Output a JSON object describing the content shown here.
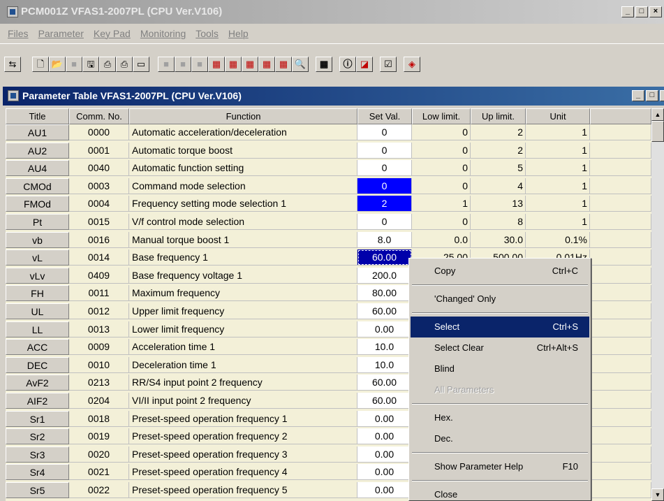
{
  "app": {
    "title": "PCM001Z VFAS1-2007PL (CPU Ver.V106)",
    "window_buttons": [
      "_",
      "□",
      "×"
    ]
  },
  "menu": [
    "Files",
    "Parameter",
    "Key Pad",
    "Monitoring",
    "Tools",
    "Help"
  ],
  "toolbar_icons": [
    "toggle-icon",
    "new-file-icon",
    "open-folder-icon",
    "blank-icon",
    "save-icon",
    "print-icon",
    "print-preview-icon",
    "window-icon",
    "blank-icon",
    "blank-icon",
    "blank-icon",
    "table-red-icon",
    "table-red-icon",
    "table-red-icon",
    "table-red-icon",
    "table-red-icon",
    "find-icon",
    "calculator-icon",
    "info-icon",
    "chart-icon",
    "checklist-icon",
    "book-icon"
  ],
  "child_window": {
    "title": "Parameter Table VFAS1-2007PL (CPU Ver.V106)"
  },
  "table": {
    "headers": [
      "Title",
      "Comm. No.",
      "Function",
      "Set Val.",
      "Low limit.",
      "Up limit.",
      "Unit",
      ""
    ],
    "rows": [
      {
        "title": "AU1",
        "comm": "0000",
        "func": "Automatic acceleration/deceleration",
        "set": "0",
        "low": "0",
        "up": "2",
        "unit": "1",
        "state": ""
      },
      {
        "title": "AU2",
        "comm": "0001",
        "func": "Automatic torque boost",
        "set": "0",
        "low": "0",
        "up": "2",
        "unit": "1",
        "state": ""
      },
      {
        "title": "AU4",
        "comm": "0040",
        "func": "Automatic function setting",
        "set": "0",
        "low": "0",
        "up": "5",
        "unit": "1",
        "state": ""
      },
      {
        "title": "CMOd",
        "comm": "0003",
        "func": "Command mode selection",
        "set": "0",
        "low": "0",
        "up": "4",
        "unit": "1",
        "state": "sel"
      },
      {
        "title": "FMOd",
        "comm": "0004",
        "func": "Frequency setting mode selection 1",
        "set": "2",
        "low": "1",
        "up": "13",
        "unit": "1",
        "state": "sel"
      },
      {
        "title": "Pt",
        "comm": "0015",
        "func": "V/f control mode selection",
        "set": "0",
        "low": "0",
        "up": "8",
        "unit": "1",
        "state": ""
      },
      {
        "title": "vb",
        "comm": "0016",
        "func": "Manual torque boost 1",
        "set": "8.0",
        "low": "0.0",
        "up": "30.0",
        "unit": "0.1%",
        "state": ""
      },
      {
        "title": "vL",
        "comm": "0014",
        "func": "Base frequency 1",
        "set": "60.00",
        "low": "25.00",
        "up": "500.00",
        "unit": "0.01Hz",
        "state": "focus"
      },
      {
        "title": "vLv",
        "comm": "0409",
        "func": "Base frequency voltage 1",
        "set": "200.0",
        "low": "",
        "up": "",
        "unit": "",
        "state": ""
      },
      {
        "title": "FH",
        "comm": "0011",
        "func": "Maximum frequency",
        "set": "80.00",
        "low": "",
        "up": "",
        "unit": "",
        "state": ""
      },
      {
        "title": "UL",
        "comm": "0012",
        "func": "Upper limit frequency",
        "set": "60.00",
        "low": "",
        "up": "",
        "unit": "",
        "state": ""
      },
      {
        "title": "LL",
        "comm": "0013",
        "func": "Lower limit frequency",
        "set": "0.00",
        "low": "",
        "up": "",
        "unit": "",
        "state": ""
      },
      {
        "title": "ACC",
        "comm": "0009",
        "func": "Acceleration time 1",
        "set": "10.0",
        "low": "",
        "up": "",
        "unit": "",
        "state": ""
      },
      {
        "title": "DEC",
        "comm": "0010",
        "func": "Deceleration time 1",
        "set": "10.0",
        "low": "",
        "up": "",
        "unit": "",
        "state": ""
      },
      {
        "title": "AvF2",
        "comm": "0213",
        "func": "RR/S4 input point 2 frequency",
        "set": "60.00",
        "low": "",
        "up": "",
        "unit": "",
        "state": ""
      },
      {
        "title": "AIF2",
        "comm": "0204",
        "func": "VI/II input point 2 frequency",
        "set": "60.00",
        "low": "",
        "up": "",
        "unit": "",
        "state": ""
      },
      {
        "title": "Sr1",
        "comm": "0018",
        "func": "Preset-speed operation frequency 1",
        "set": "0.00",
        "low": "",
        "up": "",
        "unit": "",
        "state": ""
      },
      {
        "title": "Sr2",
        "comm": "0019",
        "func": "Preset-speed operation frequency 2",
        "set": "0.00",
        "low": "",
        "up": "",
        "unit": "",
        "state": ""
      },
      {
        "title": "Sr3",
        "comm": "0020",
        "func": "Preset-speed operation frequency 3",
        "set": "0.00",
        "low": "",
        "up": "",
        "unit": "",
        "state": ""
      },
      {
        "title": "Sr4",
        "comm": "0021",
        "func": "Preset-speed operation frequency 4",
        "set": "0.00",
        "low": "",
        "up": "",
        "unit": "",
        "state": ""
      },
      {
        "title": "Sr5",
        "comm": "0022",
        "func": "Preset-speed operation frequency 5",
        "set": "0.00",
        "low": "",
        "up": "",
        "unit": "",
        "state": ""
      }
    ]
  },
  "context_menu": {
    "items": [
      {
        "label": "Copy",
        "shortcut": "Ctrl+C",
        "state": ""
      },
      {
        "sep": true
      },
      {
        "label": "'Changed' Only",
        "shortcut": "",
        "state": ""
      },
      {
        "sep": true
      },
      {
        "label": "Select",
        "shortcut": "Ctrl+S",
        "state": "hl"
      },
      {
        "label": "Select Clear",
        "shortcut": "Ctrl+Alt+S",
        "state": ""
      },
      {
        "label": "Blind",
        "shortcut": "",
        "state": ""
      },
      {
        "label": "All Parameters",
        "shortcut": "",
        "state": "dis"
      },
      {
        "sep": true
      },
      {
        "label": "Hex.",
        "shortcut": "",
        "state": ""
      },
      {
        "label": "Dec.",
        "shortcut": "",
        "state": ""
      },
      {
        "sep": true
      },
      {
        "label": "Show Parameter Help",
        "shortcut": "F10",
        "state": ""
      },
      {
        "sep": true
      },
      {
        "label": "Close",
        "shortcut": "",
        "state": ""
      }
    ]
  },
  "scrollbar": {
    "up": "▲",
    "down": "▼"
  }
}
